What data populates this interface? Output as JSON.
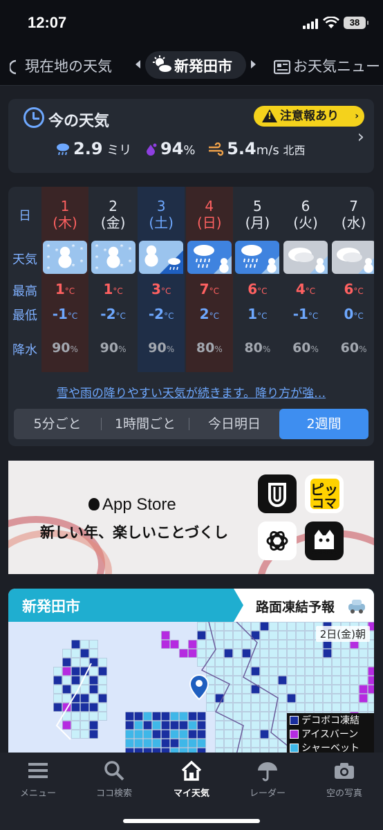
{
  "status": {
    "time": "12:07",
    "battery": "38"
  },
  "locations": {
    "prev": "現在地の天気",
    "current": "新発田市",
    "next": "お天気ニュー"
  },
  "now": {
    "title": "今の天気",
    "warning": "注意報あり",
    "precip_value": "2.9",
    "precip_unit": "ミリ",
    "humidity_value": "94",
    "humidity_unit": "%",
    "wind_value": "5.4",
    "wind_unit": "m/s",
    "wind_dir": "北西"
  },
  "forecast": {
    "labels": {
      "day": "日",
      "weather": "天気",
      "high": "最高",
      "low": "最低",
      "precip": "降水"
    },
    "temp_unit": "°C",
    "pct_unit": "%",
    "days": [
      {
        "date": "1",
        "dow": "(木)",
        "high": "1",
        "low": "-1",
        "precip": "90",
        "wx": "snow"
      },
      {
        "date": "2",
        "dow": "(金)",
        "high": "1",
        "low": "-2",
        "precip": "90",
        "wx": "snow"
      },
      {
        "date": "3",
        "dow": "(土)",
        "high": "3",
        "low": "-2",
        "precip": "90",
        "wx": "snow-rain"
      },
      {
        "date": "4",
        "dow": "(日)",
        "high": "7",
        "low": "2",
        "precip": "80",
        "wx": "rain-snow"
      },
      {
        "date": "5",
        "dow": "(月)",
        "high": "6",
        "low": "1",
        "precip": "80",
        "wx": "rain-snow"
      },
      {
        "date": "6",
        "dow": "(火)",
        "high": "4",
        "low": "-1",
        "precip": "60",
        "wx": "cloud-snow"
      },
      {
        "date": "7",
        "dow": "(水)",
        "high": "6",
        "low": "0",
        "precip": "60",
        "wx": "cloud-snow"
      }
    ],
    "note": "雪や雨の降りやすい天気が続きます。降り方が強…",
    "segments": [
      "5分ごと",
      "1時間ごと",
      "今日明日",
      "2週間"
    ],
    "active_segment": "2週間"
  },
  "ad": {
    "store": "App Store",
    "copy": "新しい年、楽しいことづくし",
    "tile_pikkoma_1": "ピッ",
    "tile_pikkoma_2": "コマ",
    "tile_abema": "ABEMA"
  },
  "road": {
    "city": "新発田市",
    "title": "路面凍結予報",
    "date": "2日(金)朝",
    "legend": [
      "デコボコ凍結",
      "アイスバーン",
      "シャーベット"
    ],
    "legend_colors": [
      "#1a2fa0",
      "#b52be0",
      "#3fb7e8"
    ]
  },
  "nav": [
    "メニュー",
    "ココ検索",
    "マイ天気",
    "レーダー",
    "空の写真"
  ],
  "colors": {
    "accent": "#3e8ef0",
    "high": "#ff6161",
    "low": "#6ea8ff",
    "warning": "#f4d21c",
    "road_head": "#1faed0"
  }
}
